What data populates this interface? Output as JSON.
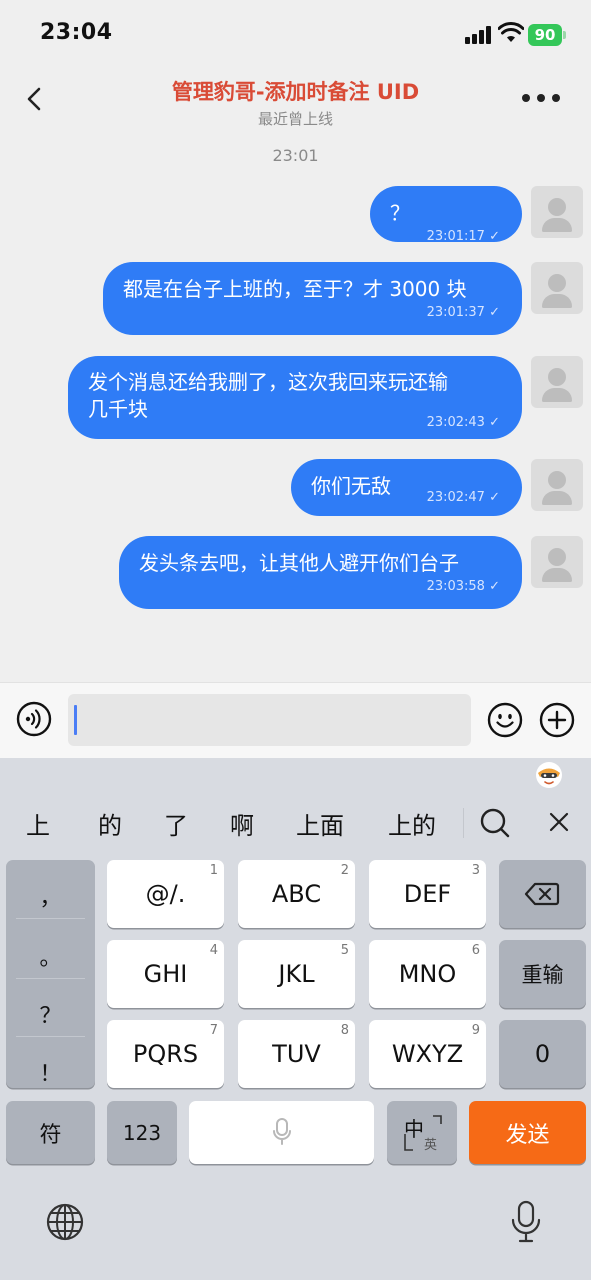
{
  "status_bar": {
    "time": "23:04",
    "battery": "90"
  },
  "nav": {
    "title": "管理豹哥-添加时备注 UID",
    "subtitle": "最近曾上线",
    "back_icon": "chevron-left-icon",
    "more_icon": "more-dots-icon"
  },
  "chat": {
    "date_stamp": "23:01",
    "messages": [
      {
        "text": "？",
        "time": "23:01:17",
        "status": "✓"
      },
      {
        "text": "都是在台子上班的，至于？才 3000 块",
        "time": "23:01:37",
        "status": "✓"
      },
      {
        "text_line1": "发个消息还给我删了，这次我回来玩还输",
        "text_line2": "几千块",
        "time": "23:02:43",
        "status": "✓"
      },
      {
        "text": "你们无敌",
        "time": "23:02:47",
        "status": "✓"
      },
      {
        "text": "发头条去吧，让其他人避开你们台子",
        "time": "23:03:58",
        "status": "✓"
      }
    ]
  },
  "input_bar": {
    "value": "",
    "placeholder": ""
  },
  "keyboard": {
    "candidates": [
      "上",
      "的",
      "了",
      "啊",
      "上面",
      "上的"
    ],
    "punctuation": [
      "，",
      "。",
      "？",
      "！"
    ],
    "keys": [
      {
        "label": "@/.",
        "num": "1"
      },
      {
        "label": "ABC",
        "num": "2"
      },
      {
        "label": "DEF",
        "num": "3"
      },
      {
        "label": "GHI",
        "num": "4"
      },
      {
        "label": "JKL",
        "num": "5"
      },
      {
        "label": "MNO",
        "num": "6"
      },
      {
        "label": "PQRS",
        "num": "7"
      },
      {
        "label": "TUV",
        "num": "8"
      },
      {
        "label": "WXYZ",
        "num": "9"
      }
    ],
    "reenter": "重输",
    "zero": "0",
    "symbols": "符",
    "numeric": "123",
    "lang_main": "中",
    "lang_sub": "英",
    "send": "发送"
  },
  "colors": {
    "bubble": "#2f7cf6",
    "title": "#d94b36",
    "send": "#f66a16"
  }
}
